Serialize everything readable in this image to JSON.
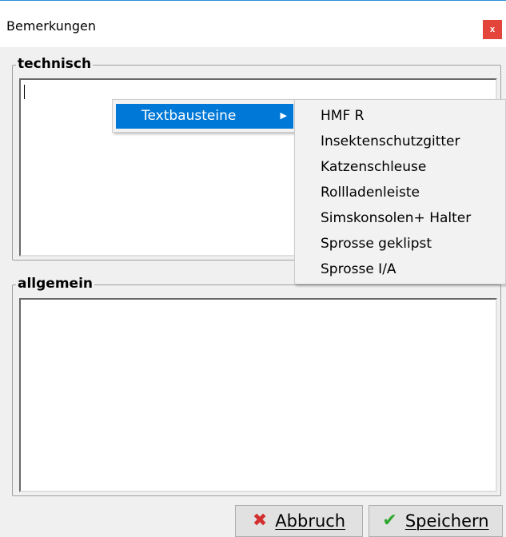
{
  "window": {
    "title": "Bemerkungen",
    "close_label": "x"
  },
  "groups": {
    "technisch": {
      "label": "technisch",
      "value": ""
    },
    "allgemein": {
      "label": "allgemein",
      "value": ""
    }
  },
  "context_menu": {
    "items": [
      {
        "label": "Textbausteine",
        "arrow": "▶"
      }
    ],
    "submenu": [
      "HMF R",
      "Insektenschutzgitter",
      "Katzenschleuse",
      "Rollladenleiste",
      "Simskonsolen+ Halter",
      "Sprosse geklipst",
      "Sprosse I/A"
    ]
  },
  "buttons": {
    "abbruch": {
      "label": "Abbruch",
      "icon": "x-icon",
      "icon_color": "#d32f2f"
    },
    "speichern": {
      "label": "Speichern",
      "icon": "check-icon",
      "icon_color": "#2ea82e"
    }
  }
}
